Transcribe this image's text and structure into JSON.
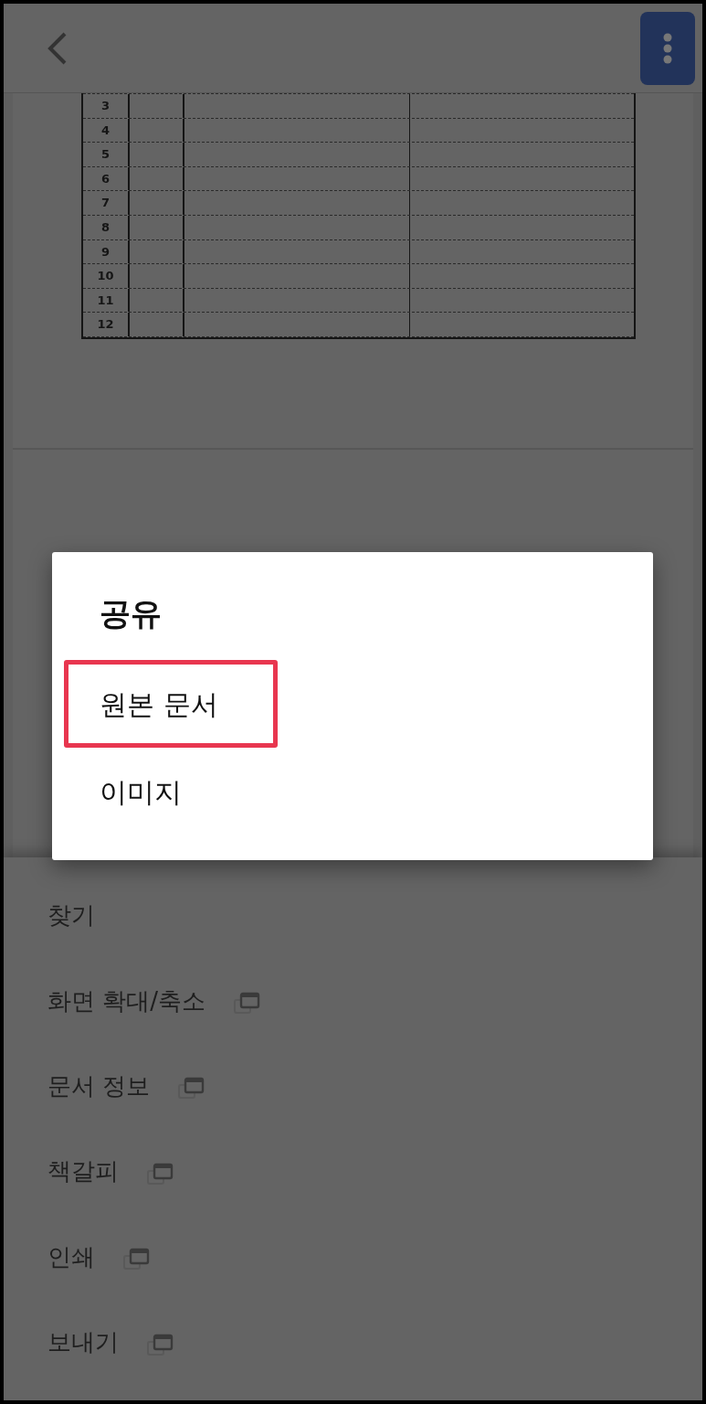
{
  "table": {
    "rows": [
      {
        "number": "3"
      },
      {
        "number": "4"
      },
      {
        "number": "5"
      },
      {
        "number": "6"
      },
      {
        "number": "7"
      },
      {
        "number": "8"
      },
      {
        "number": "9"
      },
      {
        "number": "10"
      },
      {
        "number": "11"
      },
      {
        "number": "12"
      }
    ]
  },
  "menu": {
    "items": [
      {
        "label": "찾기",
        "new_window": false
      },
      {
        "label": "화면 확대/축소",
        "new_window": true
      },
      {
        "label": "문서 정보",
        "new_window": true
      },
      {
        "label": "책갈피",
        "new_window": true
      },
      {
        "label": "인쇄",
        "new_window": true
      },
      {
        "label": "보내기",
        "new_window": true
      }
    ]
  },
  "dialog": {
    "title": "공유",
    "options": [
      {
        "label": "원본 문서",
        "highlighted": true
      },
      {
        "label": "이미지",
        "highlighted": false
      }
    ]
  }
}
